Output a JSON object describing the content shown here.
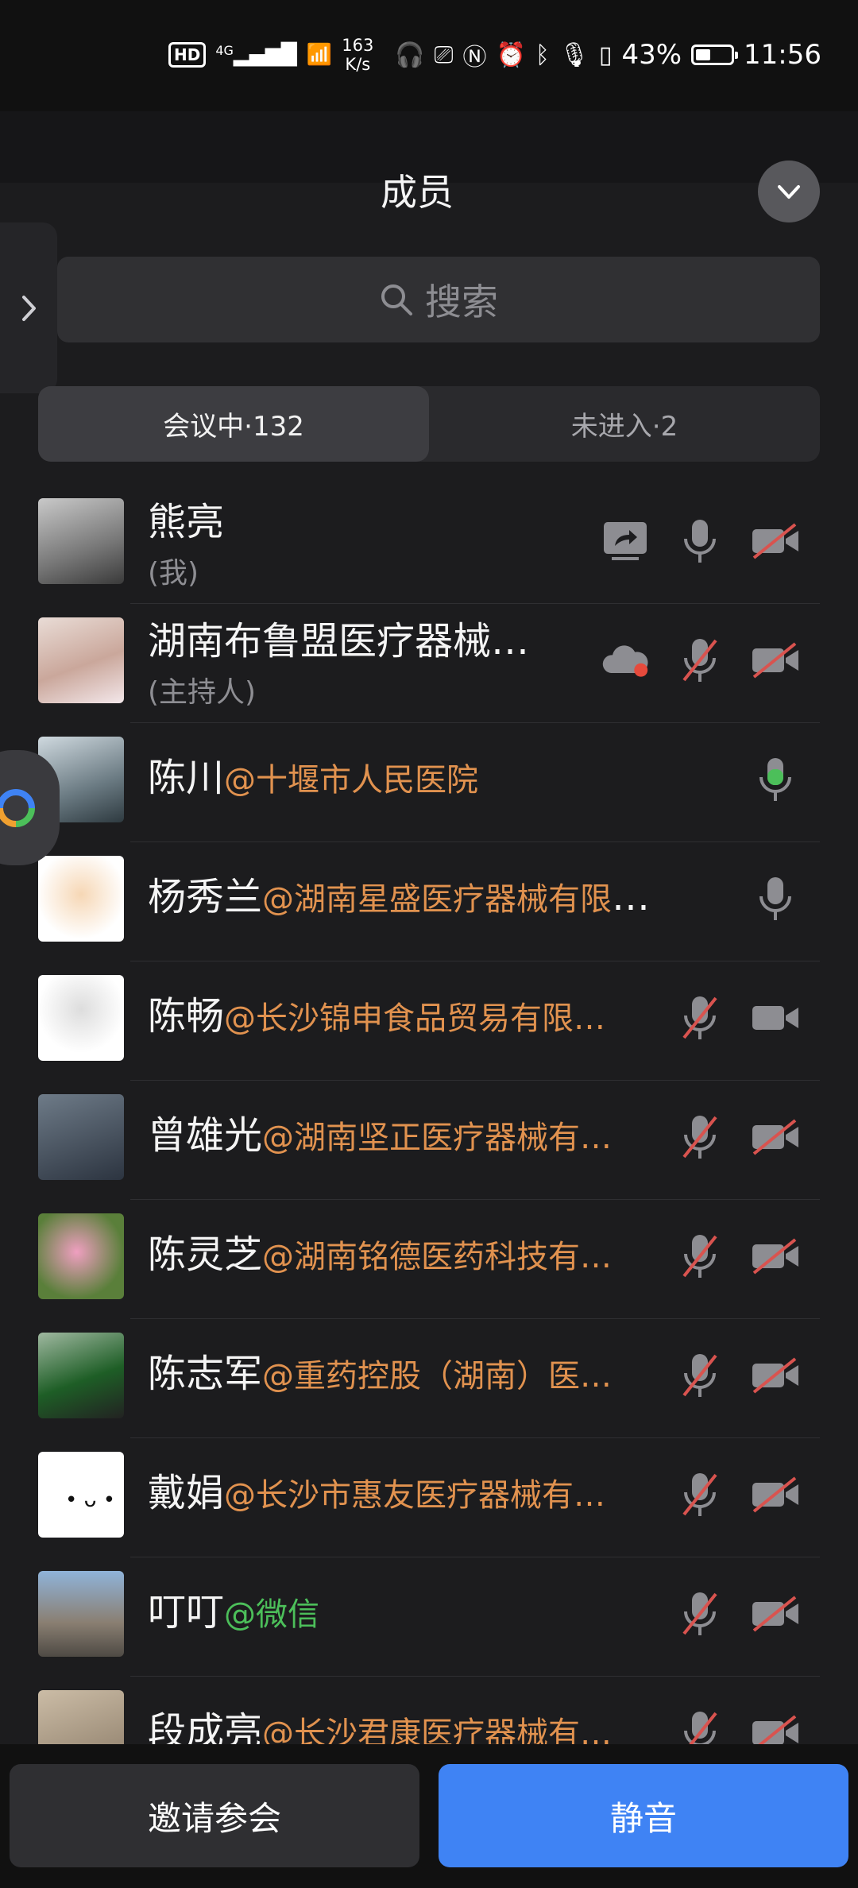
{
  "status_bar": {
    "hd": "HD",
    "network": "4G",
    "speed_value": "163",
    "speed_unit": "K/s",
    "battery": "43%",
    "battery_level": 0.43,
    "time": "11:56"
  },
  "header": {
    "title": "成员"
  },
  "search": {
    "placeholder": "搜索"
  },
  "tabs": [
    {
      "label": "会议中·132",
      "active": true
    },
    {
      "label": "未进入·2",
      "active": false
    }
  ],
  "members": [
    {
      "name": "熊亮",
      "org": "",
      "role": "(我)",
      "share": true,
      "cloud": false,
      "mic": "on",
      "cam": "off"
    },
    {
      "name": "湖南布鲁盟医疗器械…",
      "org": "",
      "role": "(主持人)",
      "share": false,
      "cloud": true,
      "mic": "off",
      "cam": "off"
    },
    {
      "name": "陈川",
      "org": "@十堰市人民医院",
      "role": "",
      "share": false,
      "cloud": false,
      "mic": "talking",
      "cam": "none"
    },
    {
      "name": "杨秀兰",
      "org": "@湖南星盛医疗器械有限公司",
      "role": "",
      "share": false,
      "cloud": false,
      "mic": "on",
      "cam": "none"
    },
    {
      "name": "陈畅",
      "org": "@长沙锦申食品贸易有限…",
      "role": "",
      "share": false,
      "cloud": false,
      "mic": "off",
      "cam": "on"
    },
    {
      "name": "曾雄光",
      "org": "@湖南坚正医疗器械有…",
      "role": "",
      "share": false,
      "cloud": false,
      "mic": "off",
      "cam": "off"
    },
    {
      "name": "陈灵芝",
      "org": "@湖南铭德医药科技有…",
      "role": "",
      "share": false,
      "cloud": false,
      "mic": "off",
      "cam": "off"
    },
    {
      "name": "陈志军",
      "org": "@重药控股（湖南）医…",
      "role": "",
      "share": false,
      "cloud": false,
      "mic": "off",
      "cam": "off"
    },
    {
      "name": "戴娟",
      "org": "@长沙市惠友医疗器械有…",
      "role": "",
      "share": false,
      "cloud": false,
      "mic": "off",
      "cam": "off"
    },
    {
      "name": "叮叮",
      "org": "@微信",
      "role": "",
      "share": false,
      "cloud": false,
      "mic": "off",
      "cam": "off"
    },
    {
      "name": "段成亮",
      "org": "@长沙君康医疗器械有…",
      "role": "",
      "share": false,
      "cloud": false,
      "mic": "off",
      "cam": "off"
    }
  ],
  "actions": {
    "invite": "邀请参会",
    "mute": "静音"
  },
  "colors": {
    "accent": "#3f83f4",
    "org_text": "#e1924f",
    "wechat": "#4cbf5a",
    "muted_slash": "#d9534f",
    "talking": "#4cbf5a"
  }
}
